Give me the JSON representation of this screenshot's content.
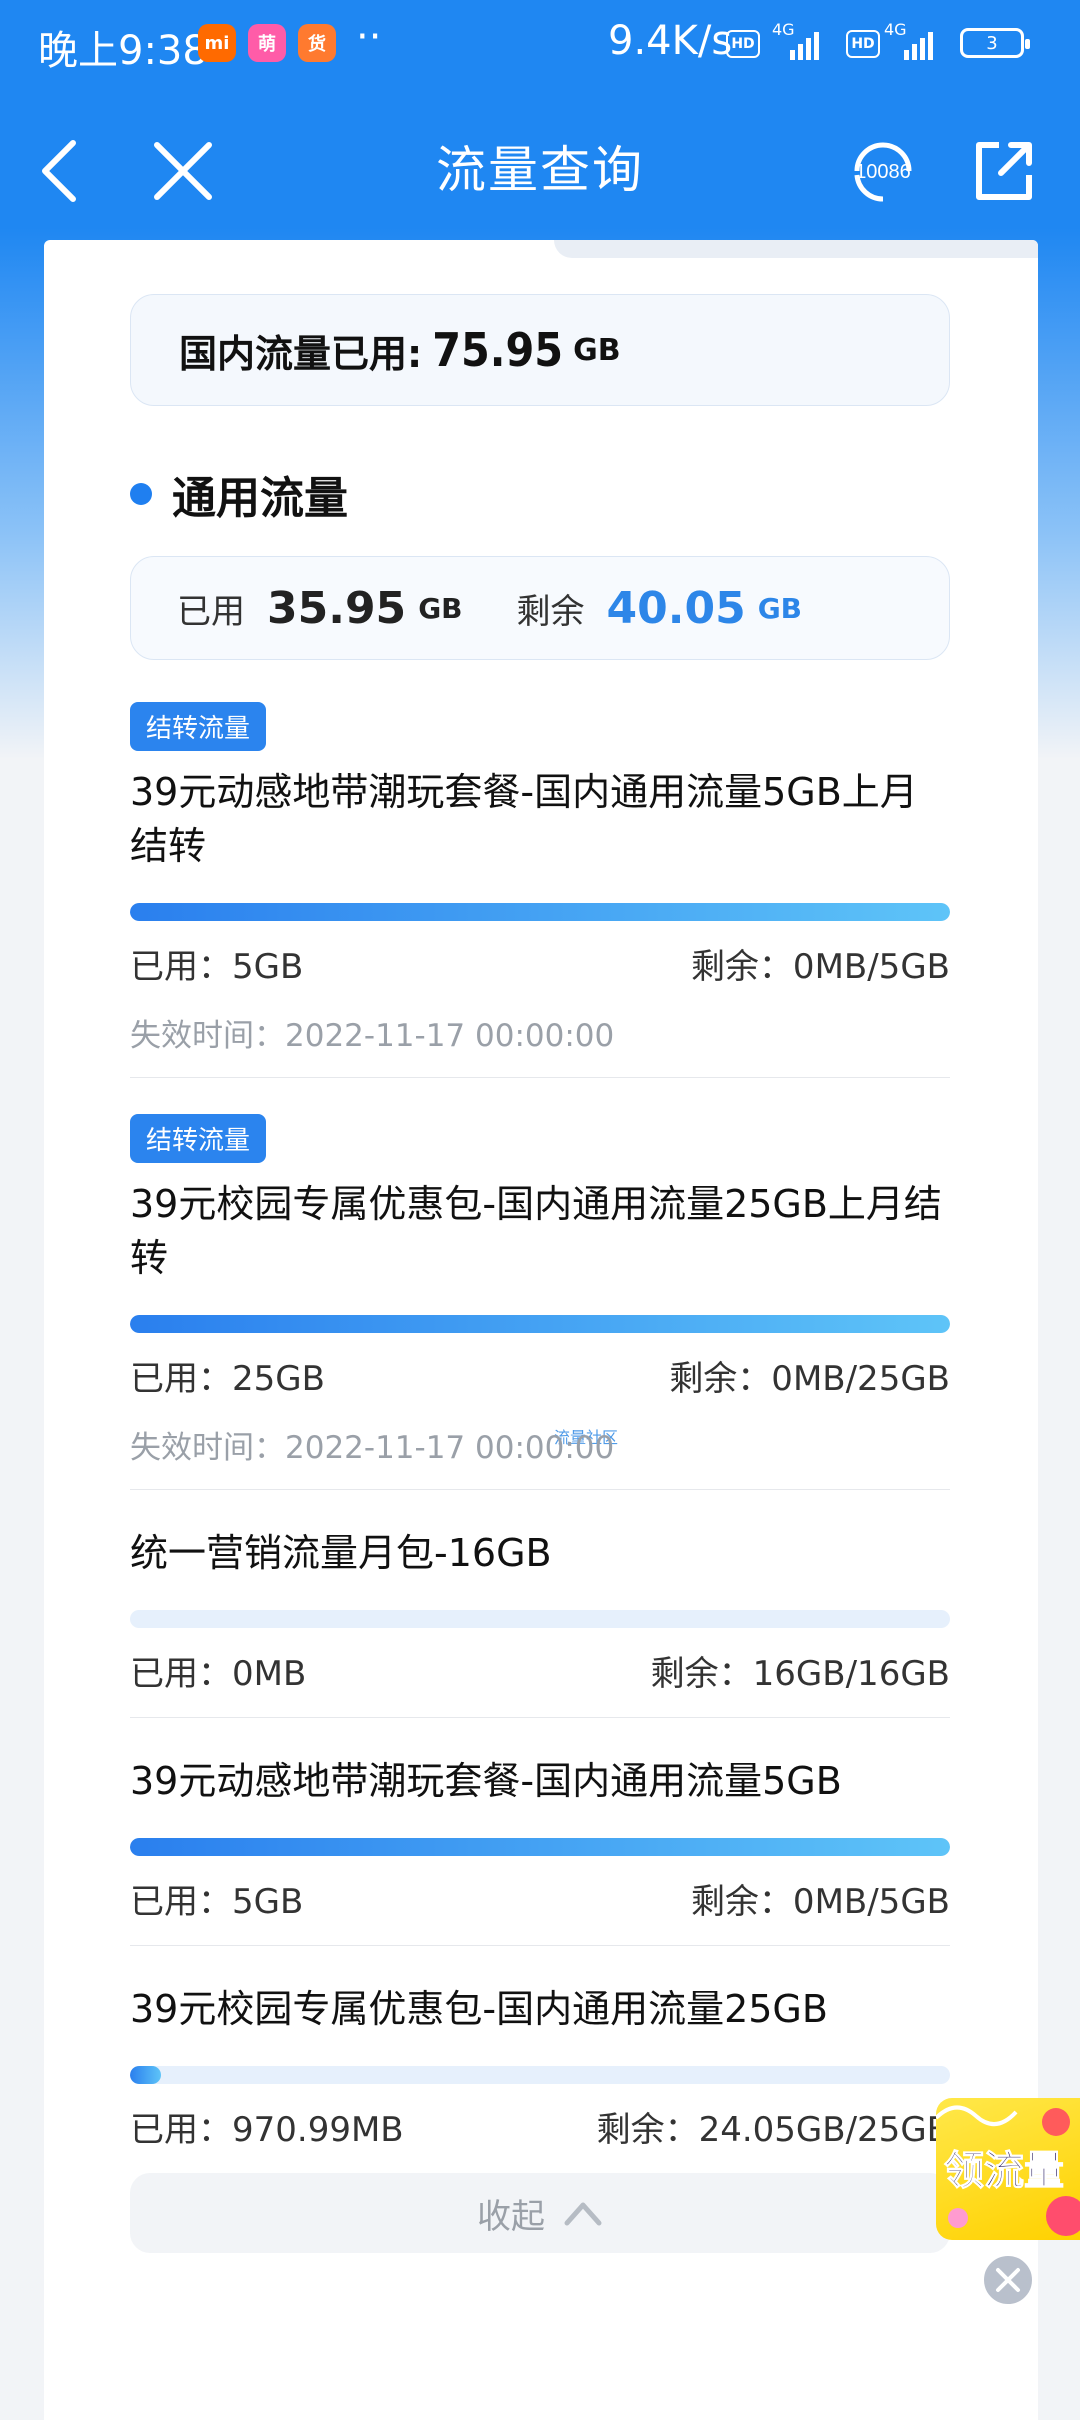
{
  "status_bar": {
    "time": "晚上9:38",
    "app_icons": [
      "mi",
      "萌",
      "货"
    ],
    "dots": "··",
    "speed": "9.4K/s",
    "hd1": "HD",
    "net1": "4G",
    "hd2": "HD",
    "net2": "4G",
    "battery": "3"
  },
  "header": {
    "title": "流量查询",
    "hotline_label": "10086"
  },
  "summary": {
    "label": "国内流量已用:",
    "value": "75.95",
    "unit": "GB"
  },
  "section": {
    "title": "通用流量",
    "used_label": "已用",
    "used_value": "35.95",
    "used_unit": "GB",
    "remain_label": "剩余",
    "remain_value": "40.05",
    "remain_unit": "GB"
  },
  "watermark": "流量社区",
  "items": [
    {
      "badge": "结转流量",
      "title": "39元动感地带潮玩套餐-国内通用流量5GB上月结转",
      "used": "已用：5GB",
      "remaining": "剩余：0MB/5GB",
      "expire": "失效时间：2022-11-17 00:00:00",
      "progress": 1.0
    },
    {
      "badge": "结转流量",
      "title": "39元校园专属优惠包-国内通用流量25GB上月结转",
      "used": "已用：25GB",
      "remaining": "剩余：0MB/25GB",
      "expire": "失效时间：2022-11-17 00:00:00",
      "progress": 1.0
    },
    {
      "title": "统一营销流量月包-16GB",
      "used": "已用：0MB",
      "remaining": "剩余：16GB/16GB",
      "progress": 0.0
    },
    {
      "title": "39元动感地带潮玩套餐-国内通用流量5GB",
      "used": "已用：5GB",
      "remaining": "剩余：0MB/5GB",
      "progress": 1.0
    },
    {
      "title": "39元校园专属优惠包-国内通用流量25GB",
      "used": "已用：970.99MB",
      "remaining": "剩余：24.05GB/25GB",
      "progress": 0.038
    }
  ],
  "collapse_label": "收起",
  "float_ad": {
    "text": "领流量"
  },
  "colors": {
    "brand_blue": "#1f87f2",
    "accent_blue": "#2d86e8"
  }
}
